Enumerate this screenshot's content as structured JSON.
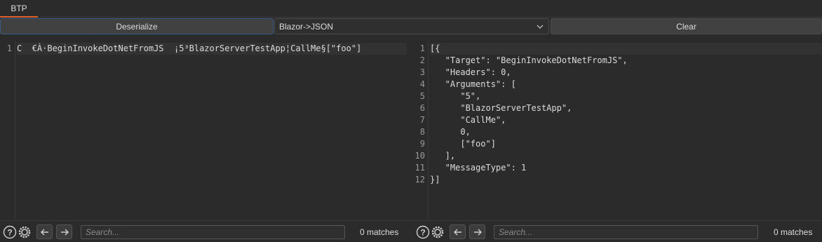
{
  "tabs": [
    {
      "label": "BTP",
      "active": true
    }
  ],
  "toolbar": {
    "deserialize_label": "Deserialize",
    "mode_selected": "Blazor->JSON",
    "clear_label": "Clear"
  },
  "left_editor": {
    "line_numbers": [
      "1"
    ],
    "lines": [
      "C  €À·BeginInvokeDotNetFromJS  ¡5³BlazorServerTestApp¦CallMe§[\"foo\"]"
    ]
  },
  "right_editor": {
    "line_numbers": [
      "1",
      "2",
      "3",
      "4",
      "5",
      "6",
      "7",
      "8",
      "9",
      "10",
      "11",
      "12"
    ],
    "lines": [
      "[{",
      "   \"Target\": \"BeginInvokeDotNetFromJS\",",
      "   \"Headers\": 0,",
      "   \"Arguments\": [",
      "      \"5\",",
      "      \"BlazorServerTestApp\",",
      "      \"CallMe\",",
      "      0,",
      "      [\"foo\"]",
      "   ],",
      "   \"MessageType\": 1",
      "}]"
    ]
  },
  "left_search": {
    "placeholder": "Search...",
    "matches": "0 matches"
  },
  "right_search": {
    "placeholder": "Search...",
    "matches": "0 matches"
  },
  "icons": {
    "help": "help-icon",
    "settings": "gear-icon",
    "prev": "arrow-left-icon",
    "next": "arrow-right-icon"
  },
  "colors": {
    "tab_accent": "#e0622f",
    "focus_border": "#3b5b86"
  }
}
